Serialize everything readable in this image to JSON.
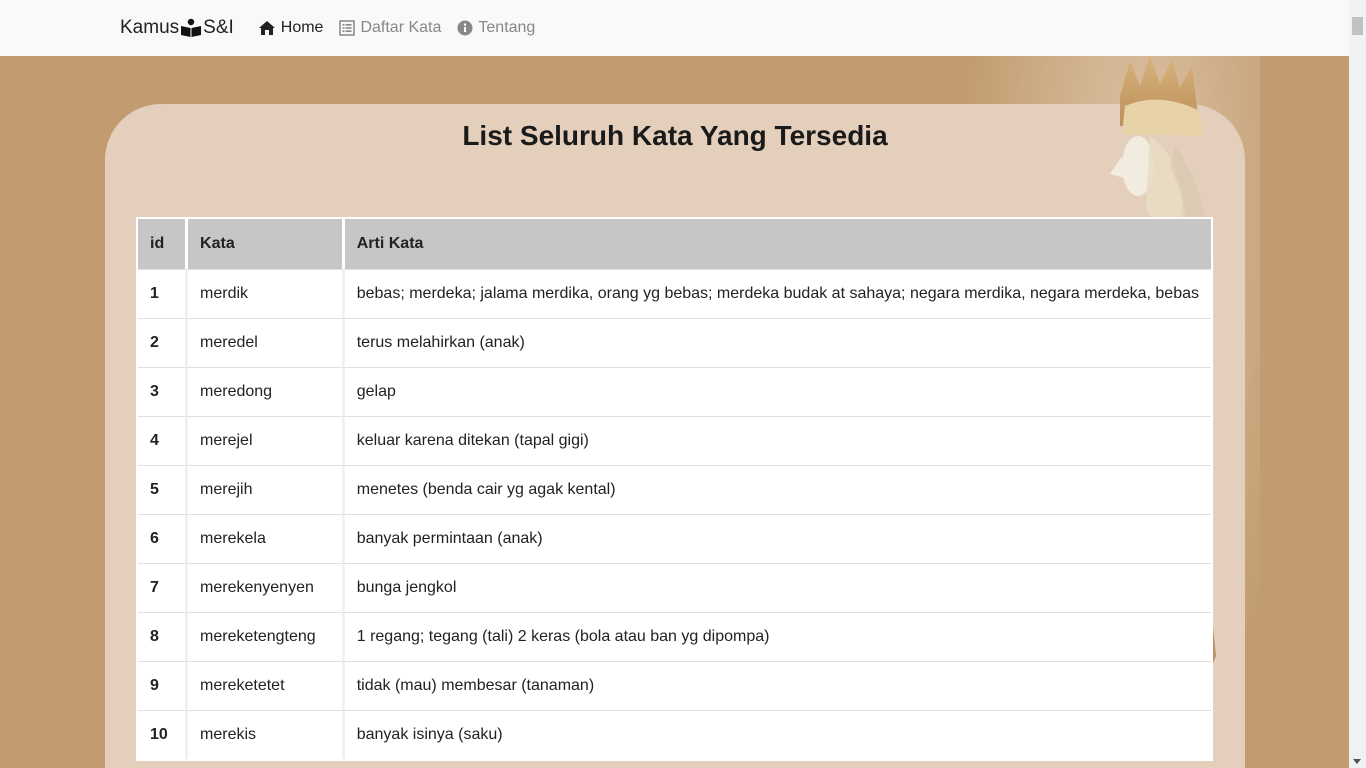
{
  "navbar": {
    "brand_left": "Kamus",
    "brand_right": "S&I",
    "items": [
      {
        "label": "Home",
        "icon": "home-icon",
        "active": true
      },
      {
        "label": "Daftar Kata",
        "icon": "list-icon",
        "active": false
      },
      {
        "label": "Tentang",
        "icon": "info-circle-icon",
        "active": false
      }
    ]
  },
  "main": {
    "title": "List Seluruh Kata Yang Tersedia",
    "table": {
      "headers": [
        "id",
        "Kata",
        "Arti Kata"
      ],
      "rows": [
        [
          "1",
          "merdik",
          "bebas; merdeka; jalama merdika, orang yg bebas; merdeka budak at sahaya; negara merdika, negara merdeka, bebas"
        ],
        [
          "2",
          "meredel",
          "terus melahirkan (anak)"
        ],
        [
          "3",
          "meredong",
          "gelap"
        ],
        [
          "4",
          "merejel",
          "keluar karena ditekan (tapal gigi)"
        ],
        [
          "5",
          "merejih",
          "menetes (benda cair yg agak kental)"
        ],
        [
          "6",
          "merekela",
          "banyak permintaan (anak)"
        ],
        [
          "7",
          "merekenyenyen",
          "bunga jengkol"
        ],
        [
          "8",
          "mereketengteng",
          "1 regang; tegang (tali) 2 keras (bola atau ban yg dipompa)"
        ],
        [
          "9",
          "mereketetet",
          "tidak (mau) membesar (tanaman)"
        ],
        [
          "10",
          "merekis",
          "banyak isinya (saku)"
        ]
      ]
    }
  },
  "colors": {
    "background": "#c29c70",
    "card": "#e3cfbb",
    "navbar": "#f8f9fa",
    "table_header": "#c6c6c6"
  }
}
